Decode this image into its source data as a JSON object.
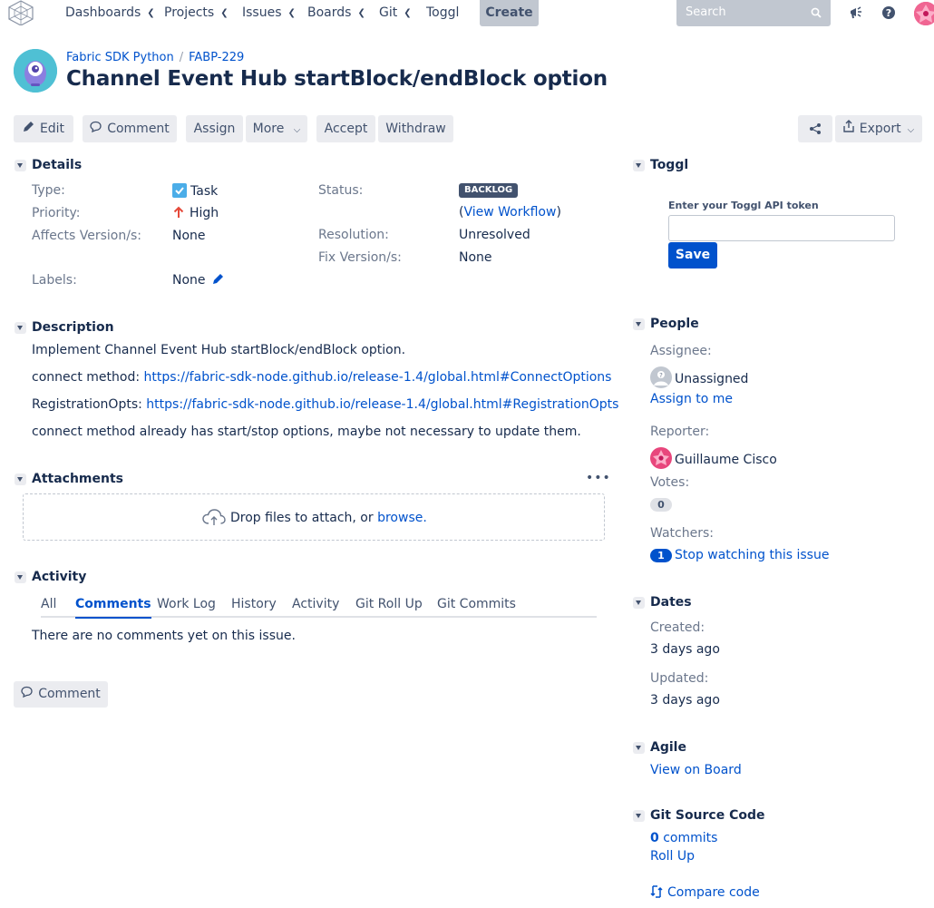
{
  "nav": {
    "items": [
      {
        "label": "Dashboards",
        "has_menu": true
      },
      {
        "label": "Projects",
        "has_menu": true
      },
      {
        "label": "Issues",
        "has_menu": true
      },
      {
        "label": "Boards",
        "has_menu": true
      },
      {
        "label": "Git",
        "has_menu": true
      },
      {
        "label": "Toggl",
        "has_menu": false
      }
    ],
    "create_label": "Create",
    "search_placeholder": "Search"
  },
  "breadcrumb": {
    "project": "Fabric SDK Python",
    "separator": "/",
    "issue_key": "FABP-229"
  },
  "issue": {
    "title": "Channel Event Hub startBlock/endBlock option"
  },
  "toolbar": {
    "edit": "Edit",
    "comment": "Comment",
    "assign": "Assign",
    "more": "More",
    "accept": "Accept",
    "withdraw": "Withdraw",
    "export": "Export"
  },
  "details": {
    "heading": "Details",
    "type_label": "Type:",
    "type_value": "Task",
    "priority_label": "Priority:",
    "priority_value": "High",
    "affects_label": "Affects Version/s:",
    "affects_value": "None",
    "labels_label": "Labels:",
    "labels_value": "None",
    "status_label": "Status:",
    "status_value": "BACKLOG",
    "view_workflow_open": "(",
    "view_workflow": "View Workflow",
    "view_workflow_close": ")",
    "resolution_label": "Resolution:",
    "resolution_value": "Unresolved",
    "fix_label": "Fix Version/s:",
    "fix_value": "None"
  },
  "description": {
    "heading": "Description",
    "line1": "Implement Channel Event Hub startBlock/endBlock option.",
    "line2_prefix": "connect method: ",
    "line2_link": "https://fabric-sdk-node.github.io/release-1.4/global.html#ConnectOptions",
    "line3_prefix": "RegistrationOpts: ",
    "line3_link": "https://fabric-sdk-node.github.io/release-1.4/global.html#RegistrationOpts",
    "line4": "connect method already has start/stop options, maybe not necessary to update them."
  },
  "attachments": {
    "heading": "Attachments",
    "drop_text": "Drop files to attach, or ",
    "browse": "browse."
  },
  "activity": {
    "heading": "Activity",
    "tabs": [
      "All",
      "Comments",
      "Work Log",
      "History",
      "Activity",
      "Git Roll Up",
      "Git Commits"
    ],
    "active_tab": "Comments",
    "empty_text": "There are no comments yet on this issue.",
    "comment_button": "Comment"
  },
  "toggl": {
    "heading": "Toggl",
    "token_label": "Enter your Toggl API token",
    "token_value": "",
    "save": "Save"
  },
  "people": {
    "heading": "People",
    "assignee_label": "Assignee:",
    "assignee_value": "Unassigned",
    "assign_to_me": "Assign to me",
    "reporter_label": "Reporter:",
    "reporter_value": "Guillaume Cisco",
    "votes_label": "Votes:",
    "votes_count": "0",
    "watchers_label": "Watchers:",
    "watchers_count": "1",
    "stop_watching": "Stop watching this issue"
  },
  "dates": {
    "heading": "Dates",
    "created_label": "Created:",
    "created_value": "3 days ago",
    "updated_label": "Updated:",
    "updated_value": "3 days ago"
  },
  "agile": {
    "heading": "Agile",
    "view_on_board": "View on Board"
  },
  "git": {
    "heading": "Git Source Code",
    "commits_count": "0",
    "commits_label": " commits",
    "roll_up": "Roll Up",
    "compare_code": "Compare code"
  },
  "colors": {
    "link": "#0052cc",
    "button_bg": "#ebecf0",
    "primary": "#0052cc",
    "priority_high": "#e5493a",
    "task_icon": "#4bade8"
  }
}
